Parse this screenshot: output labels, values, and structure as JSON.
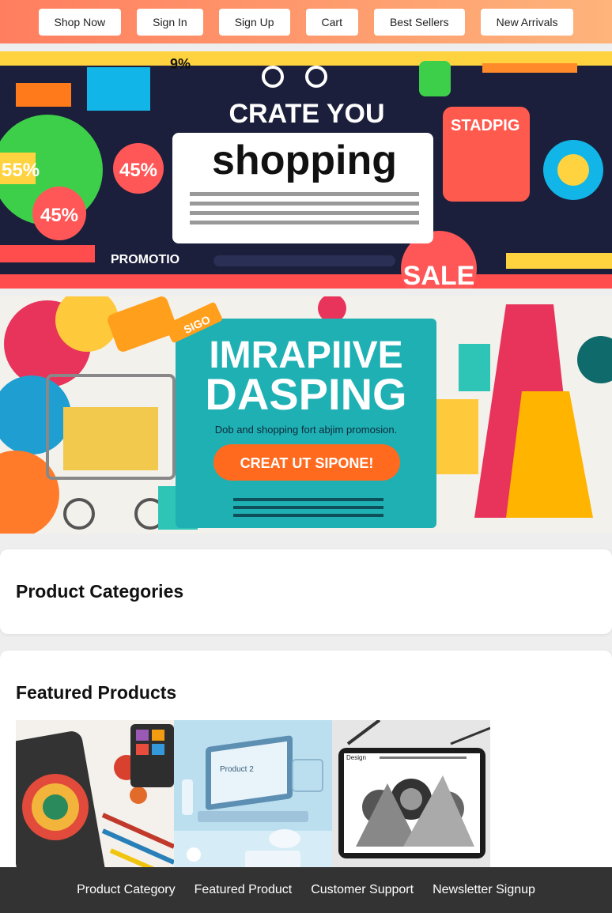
{
  "nav": {
    "items": [
      "Shop Now",
      "Sign In",
      "Sign Up",
      "Cart",
      "Best Sellers",
      "New Arrivals"
    ]
  },
  "banner1": {
    "headline": "CRATE YOU",
    "title": "shopping",
    "badges": [
      "9%",
      "55%",
      "45%",
      "45%",
      "SALE",
      "PROMOTIO",
      "STADPIG"
    ]
  },
  "banner2": {
    "headline": "IMRAPIIVE",
    "title": "DASPING",
    "subtitle": "Dob and shopping fort abjim promosion.",
    "cta": "CREAT UT SIPONE!",
    "tag": "SIGO"
  },
  "sections": {
    "categories_title": "Product Categories",
    "featured_title": "Featured Products"
  },
  "products": {
    "p2_label": "Product 2",
    "p3_label": "Design"
  },
  "footer": {
    "links": [
      "Product Category",
      "Featured Product",
      "Customer Support",
      "Newsletter Signup"
    ]
  },
  "colors": {
    "header_start": "#ff7e5f",
    "header_end": "#feb47b",
    "footer_bg": "#333333"
  }
}
